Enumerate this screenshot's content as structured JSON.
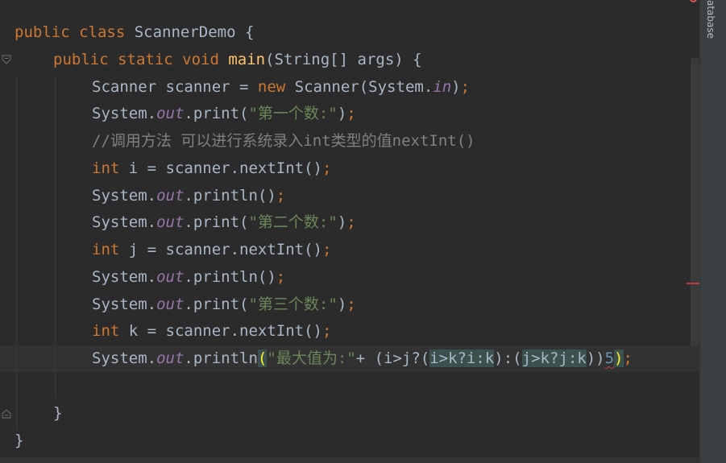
{
  "sidebar": {
    "database_tab": "atabase"
  },
  "code": {
    "l1": {
      "kw": "public class ",
      "name": "ScannerDemo {"
    },
    "l2": {
      "kw": "public static void ",
      "method": "main",
      "rest": "(String[] args) {"
    },
    "l3": {
      "t1": "Scanner scanner = ",
      "kw": "new ",
      "t2": "Scanner(System.",
      "field": "in",
      "t3": ")",
      "semi": ";"
    },
    "l4": {
      "t1": "System.",
      "field": "out",
      "t2": ".print(",
      "str": "\"第一个数:\"",
      "t3": ")",
      "semi": ";"
    },
    "l5": {
      "comment": "//调用方法 可以进行系统录入int类型的值nextInt()"
    },
    "l6": {
      "kw": "int ",
      "t1": "i = scanner.nextInt()",
      "semi": ";"
    },
    "l7": {
      "t1": "System.",
      "field": "out",
      "t2": ".println()",
      "semi": ";"
    },
    "l8": {
      "t1": "System.",
      "field": "out",
      "t2": ".print(",
      "str": "\"第二个数:\"",
      "t3": ")",
      "semi": ";"
    },
    "l9": {
      "kw": "int ",
      "t1": "j = scanner.nextInt()",
      "semi": ";"
    },
    "l10": {
      "t1": "System.",
      "field": "out",
      "t2": ".println()",
      "semi": ";"
    },
    "l11": {
      "t1": "System.",
      "field": "out",
      "t2": ".print(",
      "str": "\"第三个数:\"",
      "t3": ")",
      "semi": ";"
    },
    "l12": {
      "kw": "int ",
      "t1": "k = scanner.nextInt()",
      "semi": ";"
    },
    "l13": {
      "t1": "System.",
      "field": "out",
      "t2": ".println",
      "open": "(",
      "str": "\"最大值为:\"",
      "t3": "+ (i>j?(",
      "h1": "i>k?i:k",
      "t4": "):(",
      "h2": "j>k?j:k",
      "t5": "))",
      "num": "5",
      "close": ")",
      "semi": ";"
    },
    "l15": {
      "t1": "}"
    },
    "l16": {
      "t1": "}"
    }
  }
}
